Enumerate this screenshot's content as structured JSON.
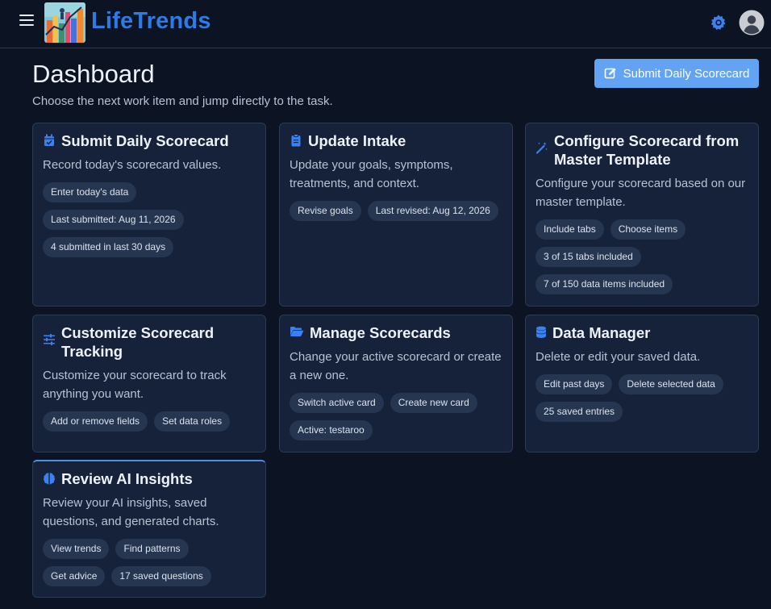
{
  "app": {
    "brand": "LifeTrends"
  },
  "header": {
    "title": "Dashboard",
    "subtitle": "Choose the next work item and jump directly to the task.",
    "primary_button": "Submit Daily Scorecard"
  },
  "colors": {
    "accent": "#2f7be6",
    "button": "#62a3f4",
    "card_bg": "#16223a",
    "page_bg": "#0c1322"
  },
  "cards": [
    {
      "icon": "calendar-check-icon",
      "title": "Submit Daily Scorecard",
      "desc": "Record today's scorecard values.",
      "chips": [
        "Enter today's data",
        "Last submitted: Aug 11, 2026",
        "4 submitted in last 30 days"
      ]
    },
    {
      "icon": "clipboard-icon",
      "title": "Update Intake",
      "desc": "Update your goals, symptoms, treatments, and context.",
      "chips": [
        "Revise goals",
        "Last revised: Aug 12, 2026"
      ]
    },
    {
      "icon": "magic-wand-icon",
      "title": "Configure Scorecard from Master Template",
      "desc": "Configure your scorecard based on our master template.",
      "chips": [
        "Include tabs",
        "Choose items",
        "3 of 15 tabs included",
        "7 of 150 data items included"
      ]
    },
    {
      "icon": "sliders-icon",
      "title": "Customize Scorecard Tracking",
      "desc": "Customize your scorecard to track anything you want.",
      "chips": [
        "Add or remove fields",
        "Set data roles"
      ]
    },
    {
      "icon": "folder-open-icon",
      "title": "Manage Scorecards",
      "desc": "Change your active scorecard or create a new one.",
      "chips": [
        "Switch active card",
        "Create new card",
        "Active: testaroo"
      ]
    },
    {
      "icon": "database-icon",
      "title": "Data Manager",
      "desc": "Delete or edit your saved data.",
      "chips": [
        "Edit past days",
        "Delete selected data",
        "25 saved entries"
      ]
    },
    {
      "icon": "brain-icon",
      "title": "Review AI Insights",
      "desc": "Review your AI insights, saved questions, and generated charts.",
      "chips": [
        "View trends",
        "Find patterns",
        "Get advice",
        "17 saved questions"
      ]
    }
  ]
}
